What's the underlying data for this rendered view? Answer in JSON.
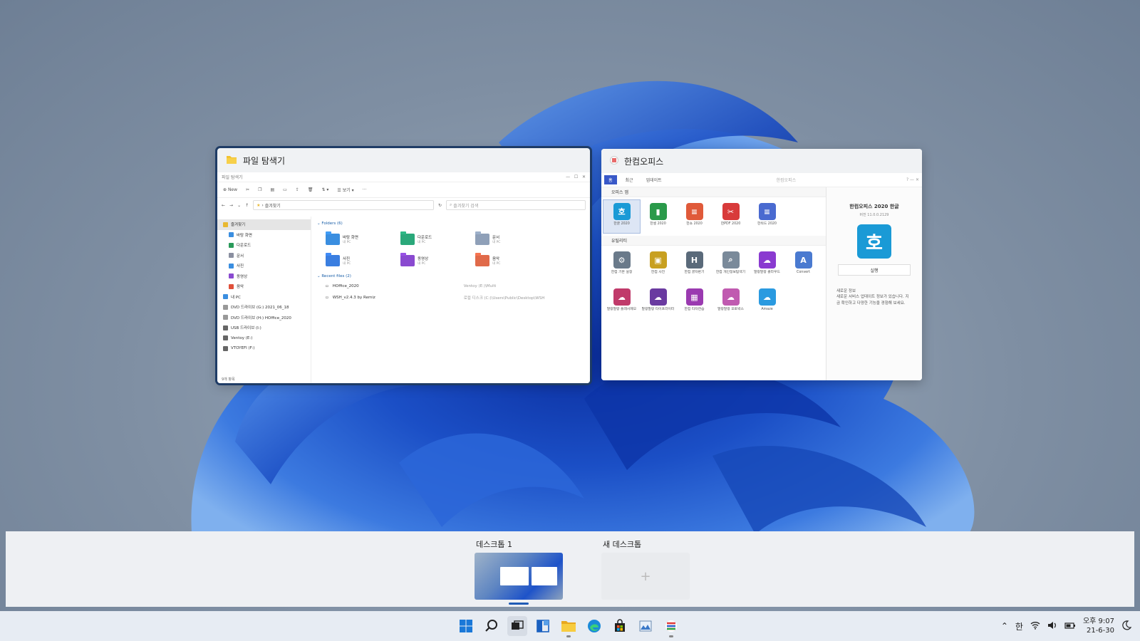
{
  "windows": {
    "explorer": {
      "caption": "파일 탐색기",
      "inner_title": "파일 탐색기",
      "toolbar_new": "New",
      "toolbar_view": "보기",
      "toolbar_more": "···",
      "address": "즐겨찾기",
      "search_placeholder": "즐겨찾기 검색",
      "nav": [
        {
          "label": "즐겨찾기",
          "color": "#e8b830"
        },
        {
          "label": "바탕 화면",
          "color": "#3a8ee0"
        },
        {
          "label": "다운로드",
          "color": "#2a9a5a"
        },
        {
          "label": "문서",
          "color": "#8a8fa0"
        },
        {
          "label": "사진",
          "color": "#3a8ee0"
        },
        {
          "label": "동영상",
          "color": "#8a4ad0"
        },
        {
          "label": "음악",
          "color": "#e0503a"
        },
        {
          "label": "내 PC",
          "color": "#3a8ee0"
        },
        {
          "label": "DVD 드라이브 (G:) 2021_06_18",
          "color": "#999999"
        },
        {
          "label": "DVD 드라이브 (H:) HOffice_2020",
          "color": "#999999"
        },
        {
          "label": "USB 드라이브 (I:)",
          "color": "#666666"
        },
        {
          "label": "Ventoy (E:)",
          "color": "#666666"
        },
        {
          "label": "VTOYEFI (F:)",
          "color": "#666666"
        }
      ],
      "folders_header": "Folders (6)",
      "folders": [
        {
          "name": "바탕 화면",
          "sub": "내 PC",
          "color": "#3a8ee0"
        },
        {
          "name": "다운로드",
          "sub": "내 PC",
          "color": "#2aa87a"
        },
        {
          "name": "문서",
          "sub": "내 PC",
          "color": "#8fa0b8"
        },
        {
          "name": "사진",
          "sub": "내 PC",
          "color": "#3a7ee0"
        },
        {
          "name": "동영상",
          "sub": "내 PC",
          "color": "#8a4ad0"
        },
        {
          "name": "음악",
          "sub": "내 PC",
          "color": "#e06a4a"
        }
      ],
      "recent_header": "Recent files (2)",
      "recent": [
        {
          "name": "HOffice_2020",
          "path": "Ventoy (E:)\\Multi"
        },
        {
          "name": "WSH_v2.4.3 by Remiz",
          "path": "로컬 디스크 (C:)\\Users\\Public\\Desktop\\WSH"
        }
      ],
      "status": "9개 항목"
    },
    "hancom": {
      "caption": "한컴오피스",
      "inner_title": "한컴오피스",
      "tabs": [
        "홈",
        "최근",
        "업데이트"
      ],
      "office_section": "오피스 앱",
      "utility_section": "유틸리티",
      "office_apps": [
        {
          "label": "한글 2020",
          "glyph": "호",
          "color": "#1a9ad6"
        },
        {
          "label": "한셀 2020",
          "glyph": "▮",
          "color": "#2a9a4a"
        },
        {
          "label": "한쇼 2020",
          "glyph": "≡",
          "color": "#e05a3a"
        },
        {
          "label": "한PDF 2020",
          "glyph": "✂",
          "color": "#d83a3a"
        },
        {
          "label": "한워드 2020",
          "glyph": "≡",
          "color": "#4a6ad0"
        }
      ],
      "utility_apps": [
        {
          "label": "한컴 기본 설정",
          "glyph": "⚙",
          "color": "#6a7a8a"
        },
        {
          "label": "한컴 사전",
          "glyph": "▣",
          "color": "#c8a020"
        },
        {
          "label": "한컴 글자판기",
          "glyph": "H",
          "color": "#5a6a7a"
        },
        {
          "label": "한컴 개인정보탐색기",
          "glyph": "⌕",
          "color": "#7a8a9a"
        },
        {
          "label": "말랑말랑 클라우드",
          "glyph": "☁",
          "color": "#8a3ad0"
        },
        {
          "label": "Convert",
          "glyph": "A",
          "color": "#4a7ad0"
        },
        {
          "label": "말랑말랑 플래시메모",
          "glyph": "☁",
          "color": "#c03a6a"
        },
        {
          "label": "말랑말랑 타이프라이터",
          "glyph": "☁",
          "color": "#6a3aa0"
        },
        {
          "label": "한컴 타자연습",
          "glyph": "▦",
          "color": "#9a3ab0"
        },
        {
          "label": "말랑말랑 포토박스",
          "glyph": "☁",
          "color": "#c05ab0"
        },
        {
          "label": "Amaze",
          "glyph": "☁",
          "color": "#2a9ae0"
        }
      ],
      "product_title": "한컴오피스 2020 한글",
      "product_version": "버전 11.0.0.2129",
      "product_glyph": "호",
      "run_button": "실행",
      "news_title": "새로운 정보",
      "news_text": "새로운 서비스 업데이트 정보가 있습니다. 지금 확인하고 다양한 기능을 경험해 보세요."
    }
  },
  "desktops": {
    "current_label": "데스크톱 1",
    "new_label": "새 데스크톱",
    "new_glyph": "+"
  },
  "taskbar": {
    "apps": [
      {
        "name": "start",
        "icon": "windows-logo-icon"
      },
      {
        "name": "search",
        "icon": "search-icon"
      },
      {
        "name": "task-view",
        "icon": "task-view-icon"
      },
      {
        "name": "snap",
        "icon": "widgets-icon"
      },
      {
        "name": "file-explorer",
        "icon": "folder-icon"
      },
      {
        "name": "edge",
        "icon": "edge-icon"
      },
      {
        "name": "store",
        "icon": "store-icon"
      },
      {
        "name": "photos",
        "icon": "chart-icon"
      },
      {
        "name": "hancom",
        "icon": "hancom-icon"
      }
    ],
    "ime": "한",
    "time": "오후 9:07",
    "date": "21-6-30"
  },
  "colors": {
    "accent": "#1f5bb5",
    "taskbar_bg": "#e7ecf3",
    "wallpaper_blue": "#1b4fc6"
  }
}
